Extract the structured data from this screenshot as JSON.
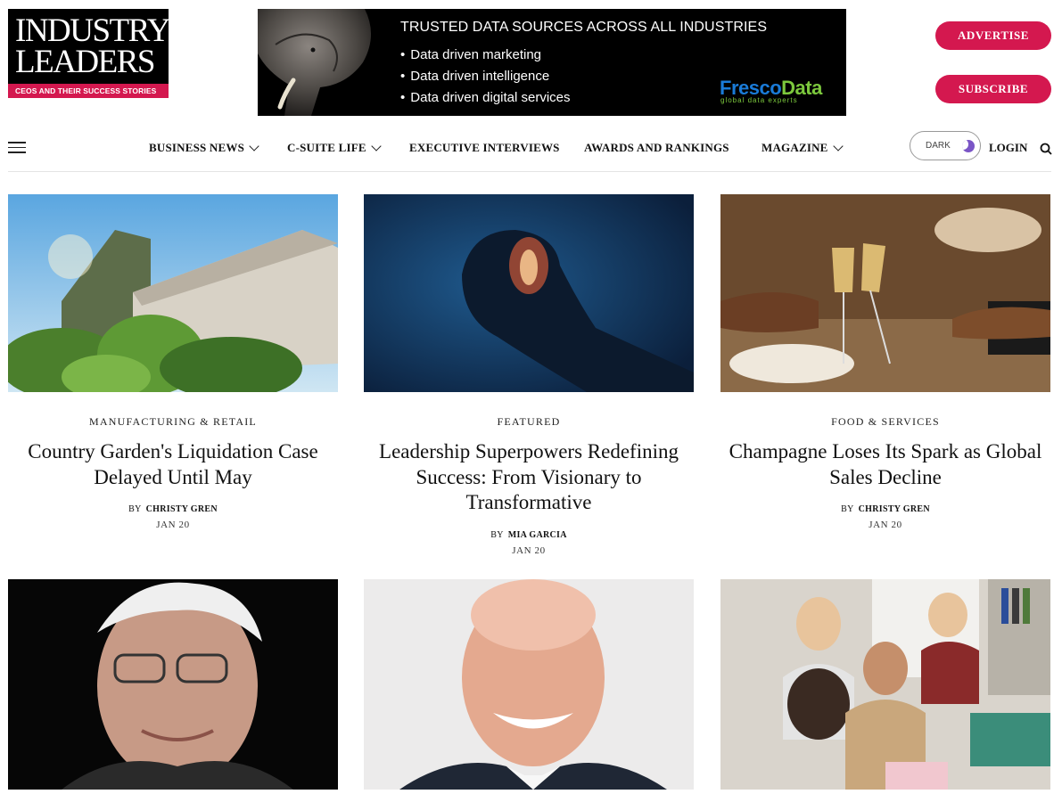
{
  "logo": {
    "line1": "INDUSTRY",
    "line2": "LEADERS",
    "tagline": "CEOS AND THEIR SUCCESS STORIES"
  },
  "banner": {
    "title": "TRUSTED DATA SOURCES ACROSS ALL INDUSTRIES",
    "bullets": [
      "Data driven marketing",
      "Data driven intelligence",
      "Data driven digital services"
    ],
    "brand_part1": "Fresco",
    "brand_part2": "Data",
    "brand_sub": "global data experts"
  },
  "buttons": {
    "advertise": "ADVERTISE",
    "subscribe": "SUBSCRIBE"
  },
  "nav": {
    "items": [
      {
        "label": "BUSINESS NEWS"
      },
      {
        "label": "C-SUITE LIFE"
      },
      {
        "label": "EXECUTIVE INTERVIEWS"
      },
      {
        "label": "AWARDS AND RANKINGS"
      },
      {
        "label": "MAGAZINE"
      }
    ],
    "dark_label": "DARK",
    "login": "LOGIN"
  },
  "articles": [
    {
      "category": "MANUFACTURING & RETAIL",
      "title": "Country Garden's Liquidation Case Delayed Until May",
      "by": "BY",
      "author": "CHRISTY GREN",
      "date": "JAN 20"
    },
    {
      "category": "FEATURED",
      "title": "Leadership Superpowers Redefining Success: From Visionary to Transformative",
      "by": "BY",
      "author": "MIA GARCIA",
      "date": "JAN 20"
    },
    {
      "category": "FOOD & SERVICES",
      "title": "Champagne Loses Its Spark as Global Sales Decline",
      "by": "BY",
      "author": "CHRISTY GREN",
      "date": "JAN 20"
    }
  ],
  "colors": {
    "brand": "#d4184f",
    "toggle_moon": "#7a55c6"
  }
}
